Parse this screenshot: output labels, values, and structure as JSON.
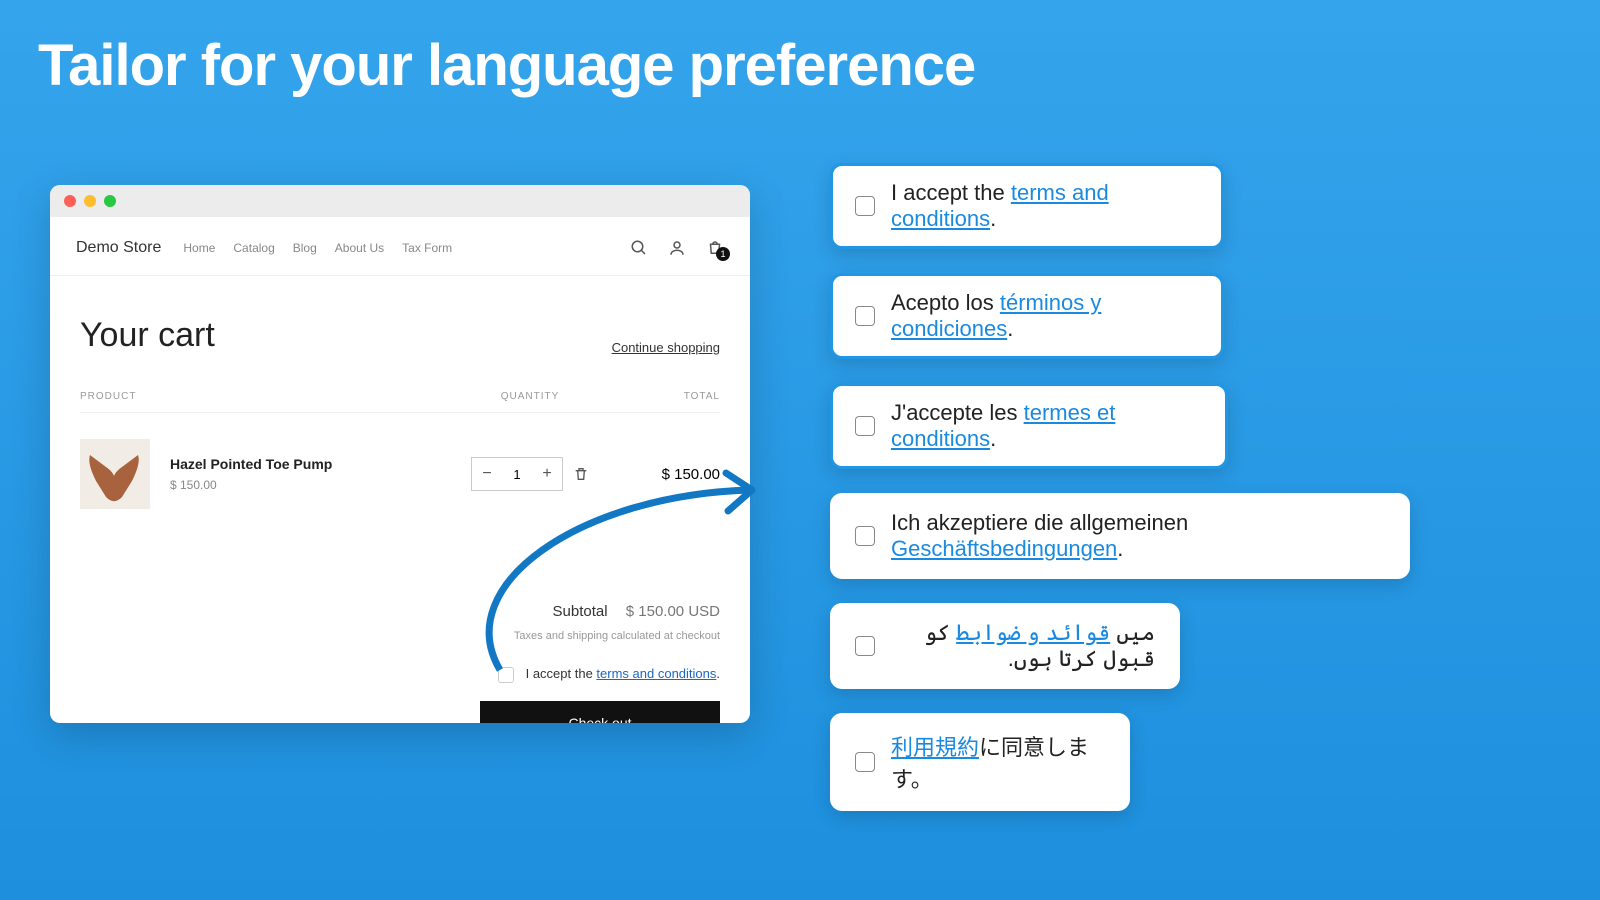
{
  "headline": "Tailor for your language preference",
  "store": {
    "brand": "Demo Store",
    "nav": [
      "Home",
      "Catalog",
      "Blog",
      "About Us",
      "Tax Form"
    ],
    "cart_badge": "1"
  },
  "cart": {
    "title": "Your cart",
    "continue": "Continue shopping",
    "cols": {
      "product": "PRODUCT",
      "qty": "QUANTITY",
      "total": "TOTAL"
    },
    "item": {
      "name": "Hazel Pointed Toe Pump",
      "price": "$ 150.00",
      "qty": "1",
      "total": "$ 150.00"
    },
    "subtotal_label": "Subtotal",
    "subtotal_value": "$ 150.00 USD",
    "taxes_note": "Taxes and shipping calculated at checkout",
    "accept_prefix": "I accept the ",
    "accept_link": "terms and conditions",
    "accept_suffix": ".",
    "checkout": "Check out"
  },
  "langs": {
    "en": {
      "pre": "I accept the ",
      "link": "terms and conditions",
      "post": "."
    },
    "es": {
      "pre": "Acepto los ",
      "link": "términos y condiciones",
      "post": "."
    },
    "fr": {
      "pre": "J'accepte les ",
      "link": "termes et conditions",
      "post": "."
    },
    "de": {
      "pre": "Ich akzeptiere die allgemeinen ",
      "link": "Geschäftsbedingungen",
      "post": "."
    },
    "ur": {
      "pre": "میں ",
      "link": "قوائد و ضوابط",
      "post": " کو قبول کرتا ہوں."
    },
    "ja": {
      "pre": "",
      "link": "利用規約",
      "post": "に同意します。"
    }
  }
}
